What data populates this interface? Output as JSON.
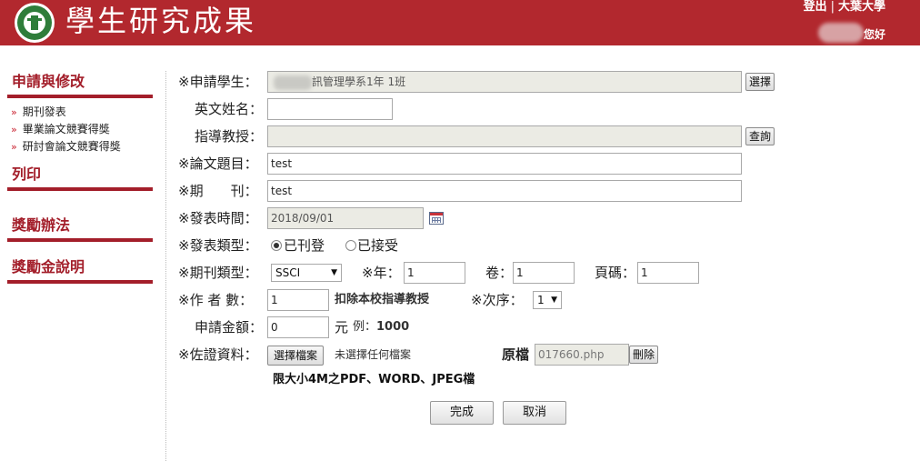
{
  "header": {
    "title": "學生研究成果",
    "logout": "登出",
    "separator": "|",
    "university": "大葉大學",
    "greeting": "您好",
    "logo_text_top": "大葉大學",
    "logo_text_ring": "DAYEH UNIVERSITY"
  },
  "sidebar": {
    "sections": [
      {
        "label": "申請與修改"
      },
      {
        "label": "列印"
      },
      {
        "label": "獎勵辦法"
      },
      {
        "label": "獎勵金說明"
      }
    ],
    "sub_items": [
      "期刊發表",
      "畢業論文競賽得獎",
      "研討會論文競賽得獎"
    ]
  },
  "form": {
    "applicant": {
      "label": "※申請學生：",
      "value": "訊管理學系1年 1班",
      "button": "選擇"
    },
    "english_name": {
      "label": "英文姓名：",
      "value": ""
    },
    "advisor": {
      "label": "指導教授：",
      "value": "",
      "button": "查詢"
    },
    "title": {
      "label": "※論文題目：",
      "value": "test"
    },
    "journal": {
      "label": "※期　　刊：",
      "value": "test"
    },
    "pub_date": {
      "label": "※發表時間：",
      "value": "2018/09/01"
    },
    "pub_type": {
      "label": "※發表類型：",
      "options": [
        "已刊登",
        "已接受"
      ],
      "selected": "已刊登"
    },
    "journal_type": {
      "label": "※期刊類型：",
      "selected": "SSCI"
    },
    "year": {
      "label": "※年：",
      "value": "1"
    },
    "volume": {
      "label": "卷：",
      "value": "1"
    },
    "pages": {
      "label": "頁碼：",
      "value": "1"
    },
    "authors": {
      "label": "※作 者 數：",
      "value": "1",
      "note": "扣除本校指導教授"
    },
    "order": {
      "label": "※次序：",
      "selected": "1"
    },
    "amount": {
      "label": "申請金額：",
      "value": "0",
      "unit": "元",
      "example_prefix": "例：",
      "example_value": "1000"
    },
    "evidence": {
      "label": "※佐證資料：",
      "choose_button": "選擇檔案",
      "no_file": "未選擇任何檔案",
      "original_label": "原檔",
      "original_value": "017660.php",
      "delete_button": "刪除",
      "limit_note": "限大小4M之PDF、WORD、JPEG檔"
    },
    "submit": "完成",
    "cancel": "取消"
  }
}
